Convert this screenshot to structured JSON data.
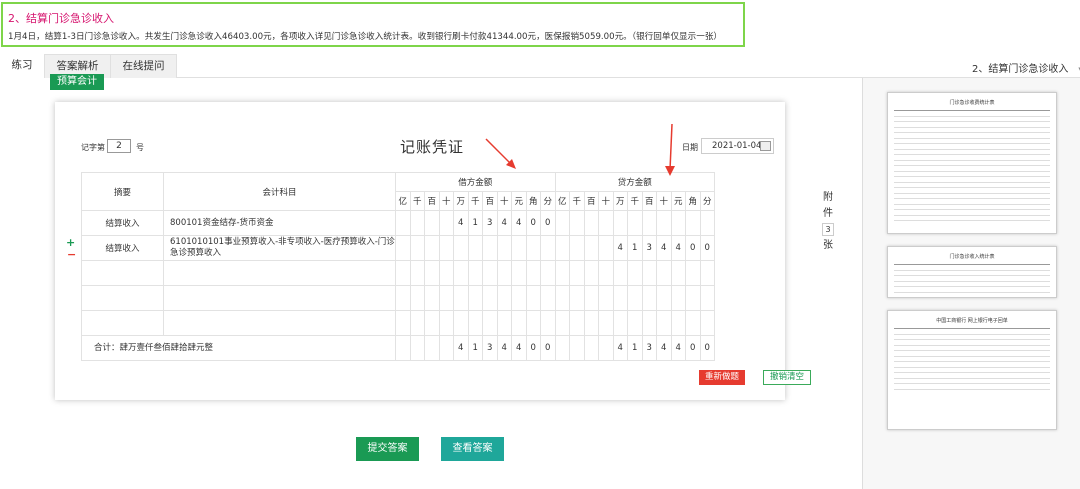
{
  "question": {
    "title": "2、结算门诊急诊收入",
    "description": "1月4日，结算1-3日门诊急诊收入。共发生门诊急诊收入46403.00元，各项收入详见门诊急诊收入统计表。收到银行刷卡付款41344.00元，医保报销5059.00元。（银行回单仅显示一张）"
  },
  "tabs": [
    "练习",
    "答案解析",
    "在线提问"
  ],
  "question_select": "2、结算门诊急诊收入",
  "budget_button": "预算会计",
  "voucher": {
    "no_label": "记字第",
    "no_value": "2",
    "no_suffix": "号",
    "title": "记账凭证",
    "date_label": "日期",
    "date_value": "2021-01-04",
    "headers": {
      "summary": "摘要",
      "account": "会计科目",
      "debit": "借方金额",
      "credit": "贷方金额",
      "units": [
        "亿",
        "千",
        "百",
        "十",
        "万",
        "千",
        "百",
        "十",
        "元",
        "角",
        "分"
      ]
    },
    "rows": [
      {
        "summary": "结算收入",
        "account": "800101资金结存-货币资金",
        "debit": [
          "",
          "",
          "",
          "",
          "4",
          "1",
          "3",
          "4",
          "4",
          "0",
          "0"
        ],
        "credit": [
          "",
          "",
          "",
          "",
          "",
          "",
          "",
          "",
          "",
          "",
          ""
        ]
      },
      {
        "summary": "结算收入",
        "account": "6101010101事业预算收入-非专项收入-医疗预算收入-门诊急诊预算收入",
        "debit": [
          "",
          "",
          "",
          "",
          "",
          "",
          "",
          "",
          "",
          "",
          ""
        ],
        "credit": [
          "",
          "",
          "",
          "",
          "4",
          "1",
          "3",
          "4",
          "4",
          "0",
          "0"
        ]
      }
    ],
    "total_label": "合计：肆万壹仟叁佰肆拾肆元整",
    "total_debit": [
      "",
      "",
      "",
      "",
      "4",
      "1",
      "3",
      "4",
      "4",
      "0",
      "0"
    ],
    "total_credit": [
      "",
      "",
      "",
      "",
      "4",
      "1",
      "3",
      "4",
      "4",
      "0",
      "0"
    ],
    "reset_label": "重新做题",
    "clear_label": "撤销清空",
    "row_add": "+",
    "row_remove": "−"
  },
  "attachments": {
    "prefix": "附件",
    "count": "3",
    "suffix": "张"
  },
  "thumbnails": [
    {
      "title": "门诊急诊收费统计表"
    },
    {
      "title": "门诊急诊收入统计表"
    },
    {
      "title": "中国工商银行 网上银行电子回单"
    }
  ],
  "submit_button": "提交答案",
  "view_button": "查看答案",
  "colors": {
    "green": "#1a9a54",
    "teal": "#1fa79a",
    "red": "#e63b2f",
    "magenta": "#d6146e",
    "question_border": "#7ed54a"
  }
}
